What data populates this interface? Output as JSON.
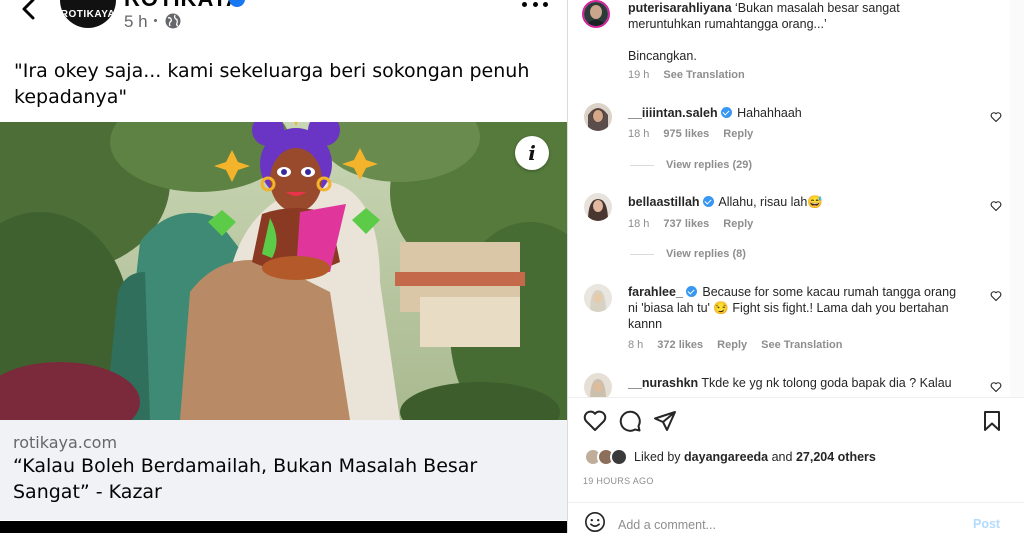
{
  "facebook_post": {
    "page_name": "ROTIKAYA",
    "avatar_logo": "ROTIKAYA",
    "time_ago": "5 h",
    "caption": "\"Ira okey saja... kami sekeluarga beri sokongan penuh kepadanya\"",
    "link_domain": "rotikaya.com",
    "link_title": "“Kalau Boleh Berdamailah, Bukan Masalah Besar Sangat” - Kazar",
    "info_symbol": "i",
    "icons": [
      "back-arrow-icon",
      "verified-icon",
      "globe-icon",
      "more-icon",
      "info-icon"
    ]
  },
  "instagram": {
    "comments": [
      {
        "username": "puterisarahliyana",
        "verified": false,
        "text": "‘Bukan masalah besar sangat meruntuhkan rumahtangga orang...’",
        "text2": "Bincangkan.",
        "time": "19 h",
        "action": "See Translation"
      },
      {
        "username": "__iiiintan.saleh",
        "verified": true,
        "text": "Hahahhaah",
        "time": "18 h",
        "likes": "975 likes",
        "reply": "Reply",
        "view_replies": "View replies (29)"
      },
      {
        "username": "bellaastillah",
        "verified": true,
        "text": "Allahu, risau lah😅",
        "time": "18 h",
        "likes": "737 likes",
        "reply": "Reply",
        "view_replies": "View replies (8)"
      },
      {
        "username": "farahlee_",
        "verified": true,
        "text": "Because for some kacau rumah tangga orang ni 'biasa lah tu' 😏 Fight sis fight.! Lama dah you bertahan kannn",
        "time": "8 h",
        "likes": "372 likes",
        "reply": "Reply",
        "action": "See Translation"
      },
      {
        "username": "__nurashkn",
        "verified": false,
        "text": "Tkde ke yg nk tolong goda bapak dia ? Kalau"
      }
    ],
    "liked_by_prefix": "Liked by",
    "liked_by_user": "dayangareeda",
    "liked_by_and": "and",
    "liked_by_others": "27,204 others",
    "timestamp": "19 HOURS AGO",
    "comment_placeholder": "Add a comment...",
    "post_label": "Post",
    "colors": {
      "link_blue": "#3897f0",
      "post_disabled": "#b3dbff",
      "fb_link_bg": "#f0f2f5"
    },
    "icons": [
      "heart-icon",
      "comment-icon",
      "share-icon",
      "bookmark-icon",
      "emoji-icon"
    ]
  }
}
